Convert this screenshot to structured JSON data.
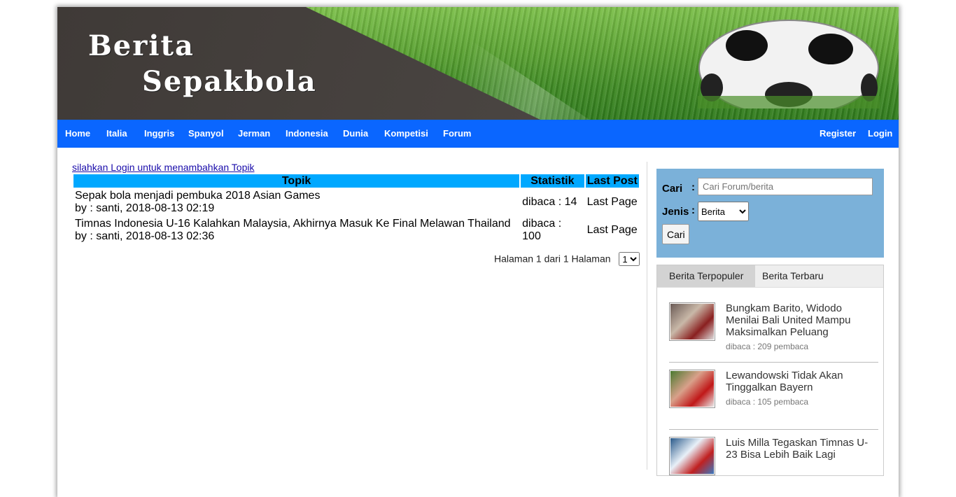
{
  "header": {
    "title_line1": "Berita",
    "title_line2": "Sepakbola"
  },
  "nav": {
    "left": [
      "Home",
      "Italia",
      "Inggris",
      "Spanyol",
      "Jerman",
      "Indonesia",
      "Dunia",
      "Kompetisi",
      "Forum"
    ],
    "right": [
      "Register",
      "Login"
    ]
  },
  "main": {
    "login_prompt": "silahkan Login untuk menambahkan Topik",
    "columns": [
      "Topik",
      "Statistik",
      "Last Post"
    ],
    "rows": [
      {
        "title": "Sepak bola menjadi pembuka 2018 Asian Games",
        "by": "by : santi, 2018-08-13 02:19",
        "stat": "dibaca : 14",
        "last": "Last Page"
      },
      {
        "title": "Timnas Indonesia U-16 Kalahkan Malaysia, Akhirnya Masuk Ke Final Melawan Thailand",
        "by": "by : santi, 2018-08-13 02:36",
        "stat": "dibaca : 100",
        "last": "Last Page"
      }
    ],
    "pager_text": "Halaman 1 dari 1 Halaman",
    "pager_selected": "1"
  },
  "search": {
    "cari_label": "Cari",
    "colon": ":",
    "placeholder": "Cari Forum/berita",
    "jenis_label": "Jenis",
    "jenis_selected": "Berita",
    "button": "Cari"
  },
  "sidebar": {
    "tabs": [
      "Berita Terpopuler",
      "Berita Terbaru"
    ],
    "news": [
      {
        "title": "Bungkam Barito, Widodo Menilai Bali United Mampu Maksimalkan Peluang",
        "count": "dibaca : 209 pembaca"
      },
      {
        "title": "Lewandowski Tidak Akan Tinggalkan Bayern",
        "count": "dibaca : 105 pembaca"
      },
      {
        "title": "Luis Milla Tegaskan Timnas U-23 Bisa Lebih Baik Lagi",
        "count": ""
      }
    ]
  },
  "colors": {
    "nav": "#0a66ff",
    "table_header": "#00a8ff",
    "search_bg": "#7bb1d9"
  }
}
